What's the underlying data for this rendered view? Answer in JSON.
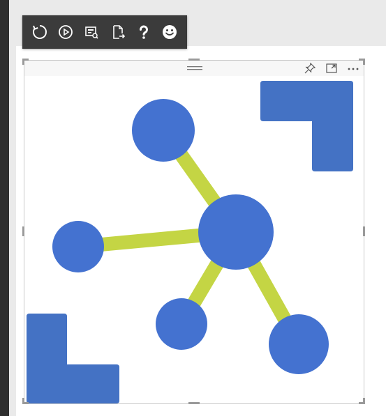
{
  "toolbar": {
    "buttons": [
      {
        "name": "refresh",
        "icon": "refresh-icon"
      },
      {
        "name": "play",
        "icon": "play-icon"
      },
      {
        "name": "report",
        "icon": "report-icon"
      },
      {
        "name": "export",
        "icon": "export-icon"
      },
      {
        "name": "help",
        "icon": "question-icon"
      },
      {
        "name": "feedback",
        "icon": "smiley-icon"
      }
    ]
  },
  "visual_header": {
    "icons": [
      "pin-icon",
      "focus-mode-icon",
      "more-options-icon"
    ]
  },
  "colors": {
    "node": "#4472d0",
    "edge": "#c4d544",
    "corner_shape": "#4472c4",
    "toolbar_bg": "#3b3b3b",
    "left_strip": "#2e2e2e"
  }
}
